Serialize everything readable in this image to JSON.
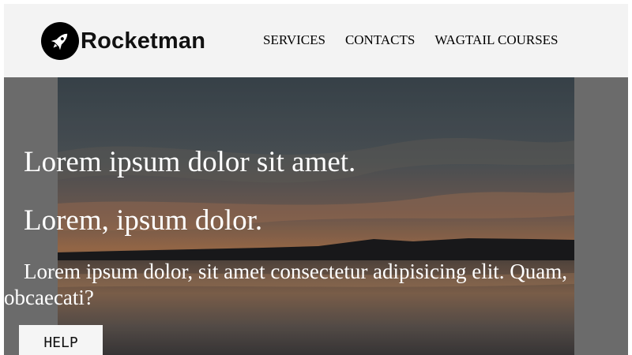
{
  "brand": {
    "name": "Rocketman",
    "icon": "rocket-icon"
  },
  "nav": {
    "items": [
      {
        "label": "SERVICES"
      },
      {
        "label": "CONTACTS"
      },
      {
        "label": "WAGTAIL COURSES"
      }
    ]
  },
  "hero": {
    "title": "Lorem ipsum dolor sit amet.",
    "subtitle": "Lorem, ipsum dolor.",
    "text": "Lorem ipsum dolor, sit amet consectetur adipisicing elit. Quam, obcaecati?",
    "button_label": "HELP"
  },
  "colors": {
    "header_bg": "#f3f3f3",
    "hero_text": "#ffffff",
    "button_bg": "#f5f5f5"
  }
}
